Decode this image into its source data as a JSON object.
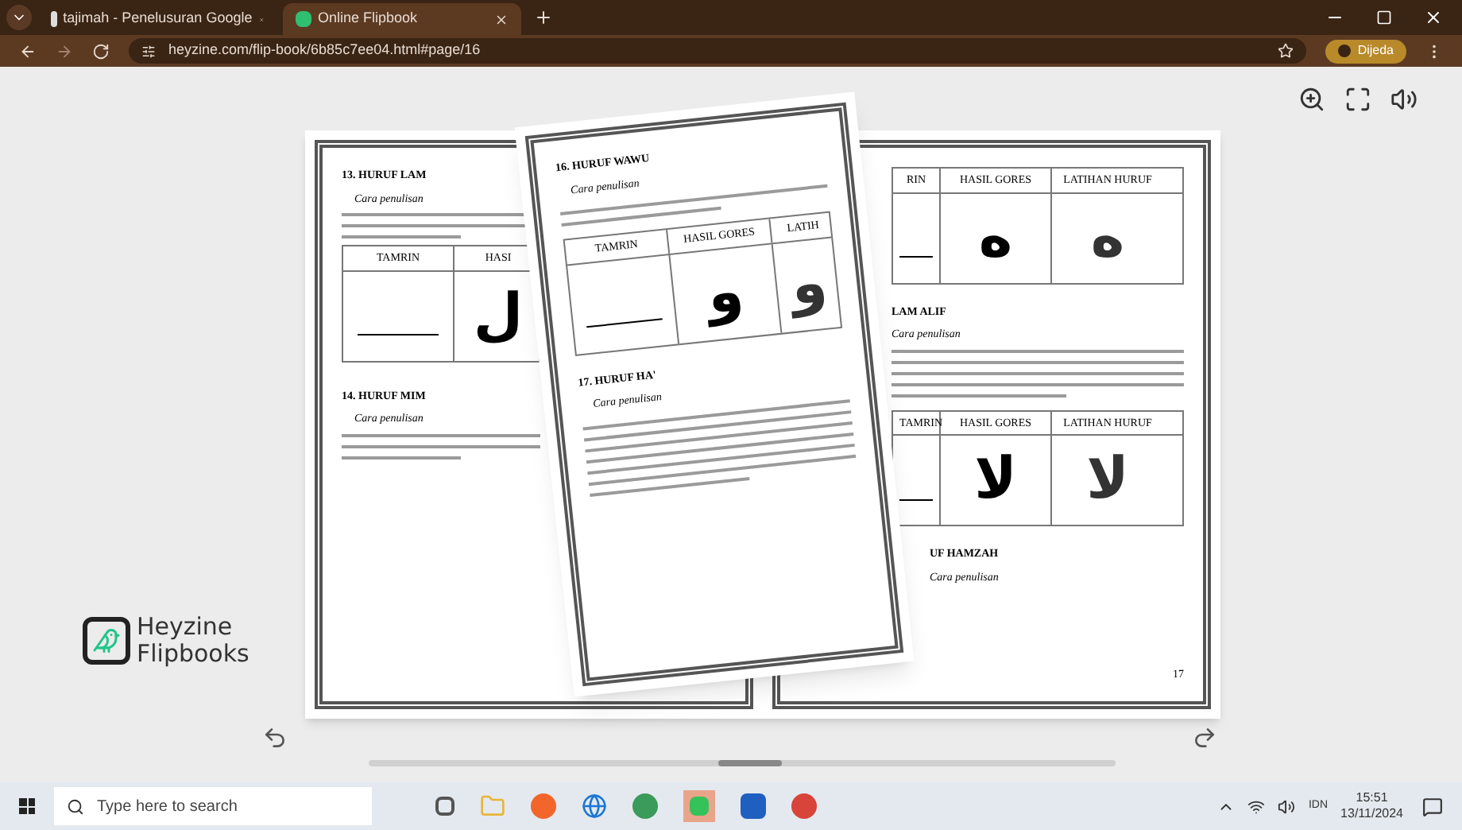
{
  "browser": {
    "tabs": [
      {
        "title": "tajimah - Penelusuran Google",
        "selected": false
      },
      {
        "title": "Online Flipbook",
        "selected": true
      }
    ],
    "url": "heyzine.com/flip-book/6b85c7ee04.html#page/16",
    "profile": "Dijeda"
  },
  "viewer": {
    "logo": {
      "line1": "Heyzine",
      "line2": "Flipbooks"
    }
  },
  "left_page": {
    "sections": [
      {
        "heading": "13. HURUF LAM",
        "subheading": "Cara penulisan",
        "table": {
          "columns": [
            "TAMRIN",
            "HASI"
          ],
          "letter": "ل"
        }
      },
      {
        "heading": "14. HURUF MIM",
        "subheading": "Cara penulisan"
      }
    ]
  },
  "turning_page": {
    "sections": [
      {
        "heading": "16. HURUF WAWU",
        "subheading": "Cara penulisan",
        "table": {
          "columns": [
            "TAMRIN",
            "HASIL GORES",
            "LATIH"
          ],
          "letter": "و",
          "practice_letter": "و"
        }
      },
      {
        "heading": "17. HURUF HA'",
        "subheading": "Cara penulisan"
      }
    ]
  },
  "right_page": {
    "tables": [
      {
        "columns": [
          "RIN",
          "HASIL GORES",
          "LATIHAN HURUF"
        ],
        "letter": "ه",
        "practice_letter": "ه"
      },
      {
        "columns": [
          "TAMRIN",
          "HASIL GORES",
          "LATIHAN HURUF"
        ],
        "letter": "لا",
        "practice_letter": "لا"
      }
    ],
    "heading": "LAM ALIF",
    "subheading": "Cara penulisan",
    "last_heading": "UF HAMZAH",
    "last_subheading": "Cara penulisan",
    "page_number": "17"
  },
  "taskbar": {
    "search_placeholder": "Type here to search",
    "language": "IDN",
    "time": "15:51",
    "date": "13/11/2024"
  }
}
